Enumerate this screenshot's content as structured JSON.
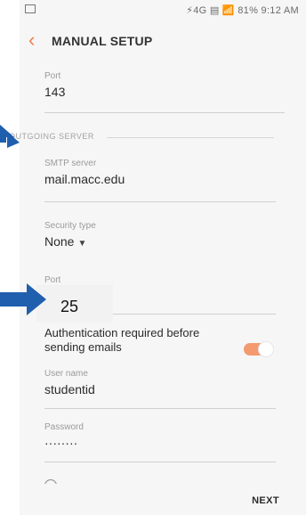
{
  "status_bar": {
    "right_text": "⚡4G ▤ 📶 81% 9:12 AM"
  },
  "appbar": {
    "back_icon": "chevron-left-icon",
    "title": "MANUAL SETUP"
  },
  "fields": {
    "incoming_port": {
      "label": "Port",
      "value": "143"
    },
    "section_outgoing": "OUTGOING SERVER",
    "smtp_server": {
      "label": "SMTP server",
      "value": "mail.macc.edu"
    },
    "security_type": {
      "label": "Security type",
      "value": "None"
    },
    "outgoing_port": {
      "label": "Port",
      "value": "25"
    },
    "auth_required": {
      "label": "Authentication required before sending emails",
      "enabled": true
    },
    "user_name": {
      "label": "User name",
      "value": "studentid"
    },
    "password": {
      "label": "Password",
      "value": "········"
    }
  },
  "footer": {
    "next_label": "NEXT"
  },
  "colors": {
    "accent": "#f07d4b",
    "toggle_on": "#f39a70",
    "annotation_arrow": "#1f5fae"
  }
}
